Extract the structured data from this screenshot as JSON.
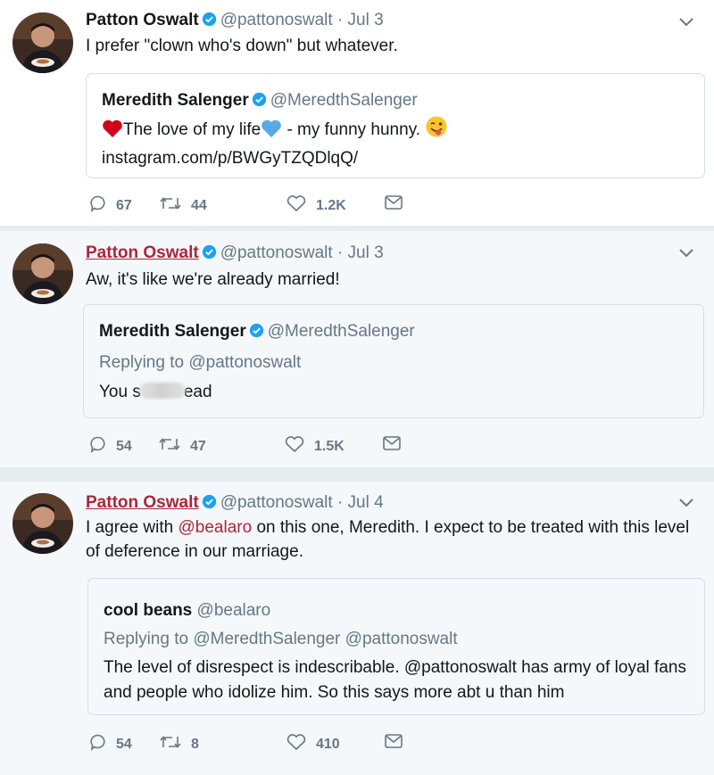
{
  "tweets": [
    {
      "author_name": "Patton Oswalt",
      "handle": "@pattonoswalt",
      "date": "· Jul 3",
      "text": "I prefer \"clown who's down\" but whatever.",
      "quote": {
        "name": "Meredith Salenger",
        "handle": "@MeredthSalenger",
        "text_a": "The love of my life",
        "text_b": " - my funny hunny.",
        "link": "instagram.com/p/BWGyTZQDlqQ/"
      },
      "replies": "67",
      "retweets": "44",
      "likes": "1.2K"
    },
    {
      "author_name": "Patton Oswalt",
      "handle": "@pattonoswalt",
      "date": "· Jul 3",
      "text": "Aw, it's like we're already married!",
      "quote": {
        "name": "Meredith Salenger",
        "handle": "@MeredthSalenger",
        "replying": "Replying to @pattonoswalt",
        "text_a": "You s",
        "text_b": "ead"
      },
      "replies": "54",
      "retweets": "47",
      "likes": "1.5K"
    },
    {
      "author_name": "Patton Oswalt",
      "handle": "@pattonoswalt",
      "date": "· Jul 4",
      "text_a": "I agree with ",
      "mention": "@bealaro",
      "text_b": " on this one, Meredith. I expect to be treated with this level of deference in our marriage.",
      "quote": {
        "name": "cool beans",
        "handle": "@bealaro",
        "replying": "Replying to @MeredthSalenger @pattonoswalt",
        "text": "The level of disrespect is indescribable. @pattonoswalt has army of loyal fans and people who idolize him. So this says more abt u than him"
      },
      "replies": "54",
      "retweets": "8",
      "likes": "410"
    }
  ],
  "colors": {
    "verified": "#1da1f2",
    "muted": "#657786",
    "link_red": "#b0243b",
    "heart_red": "#d0021b",
    "heart_blue": "#5aa9e6"
  },
  "icons": [
    "avatar",
    "verified-badge-icon",
    "chevron-down-icon",
    "reply-icon",
    "retweet-icon",
    "like-icon",
    "direct-message-icon",
    "red-heart-emoji",
    "blue-heart-emoji",
    "winking-tongue-emoji"
  ]
}
